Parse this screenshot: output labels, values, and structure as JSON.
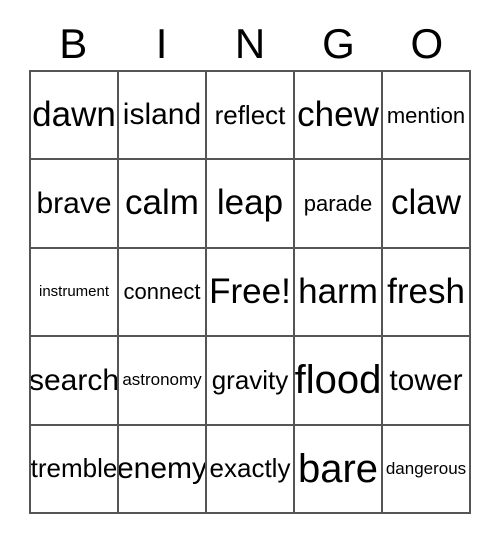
{
  "card": {
    "title_letters": [
      "B",
      "I",
      "N",
      "G",
      "O"
    ],
    "columns": 5,
    "rows": 5,
    "border_color": "#555555",
    "text_color": "#000000",
    "background_color": "#ffffff",
    "free_space": {
      "row": 2,
      "col": 2,
      "label": "Free!"
    },
    "cells": [
      [
        {
          "text": "dawn",
          "size": "lg"
        },
        {
          "text": "island",
          "size": "md"
        },
        {
          "text": "reflect",
          "size": "sm"
        },
        {
          "text": "chew",
          "size": "lg"
        },
        {
          "text": "mention",
          "size": "xs"
        }
      ],
      [
        {
          "text": "brave",
          "size": "md"
        },
        {
          "text": "calm",
          "size": "lg"
        },
        {
          "text": "leap",
          "size": "lg"
        },
        {
          "text": "parade",
          "size": "xs"
        },
        {
          "text": "claw",
          "size": "lg"
        }
      ],
      [
        {
          "text": "instrument",
          "size": "tiny"
        },
        {
          "text": "connect",
          "size": "xs"
        },
        {
          "text": "Free!",
          "size": "lg"
        },
        {
          "text": "harm",
          "size": "lg"
        },
        {
          "text": "fresh",
          "size": "lg"
        }
      ],
      [
        {
          "text": "search",
          "size": "md"
        },
        {
          "text": "astronomy",
          "size": "xxs"
        },
        {
          "text": "gravity",
          "size": "sm"
        },
        {
          "text": "flood",
          "size": "xl"
        },
        {
          "text": "tower",
          "size": "md"
        }
      ],
      [
        {
          "text": "tremble",
          "size": "sm"
        },
        {
          "text": "enemy",
          "size": "md"
        },
        {
          "text": "exactly",
          "size": "sm"
        },
        {
          "text": "bare",
          "size": "xl"
        },
        {
          "text": "dangerous",
          "size": "xxs"
        }
      ]
    ]
  }
}
